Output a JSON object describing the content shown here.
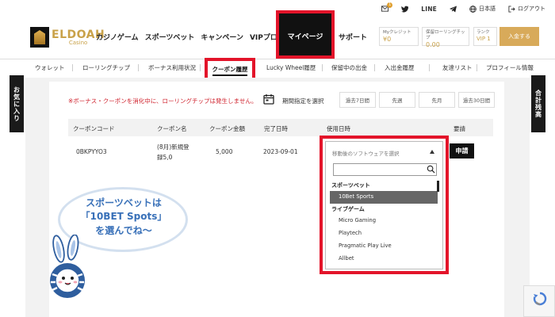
{
  "util_bar": {
    "mail_badge": "1",
    "line_label": "LINE",
    "lang_label": "日本語",
    "logout_label": "ログアウト"
  },
  "logo": {
    "main": "ELDOAH",
    "sub": "Casino"
  },
  "nav": {
    "items": [
      "カジノゲーム",
      "スポーツベット",
      "キャンペーン",
      "VIPプログラム"
    ],
    "mypage": "マイページ",
    "support": "サポート"
  },
  "account": {
    "credit_label": "Myクレジット",
    "credit_value": "¥0",
    "rolling_label": "保留ローリングチップ",
    "rolling_value": "0.00",
    "rank_label": "ランク",
    "rank_value": "VIP 1",
    "deposit_label": "入金する"
  },
  "subnav": {
    "tabs": [
      "ウォレット",
      "ローリングチップ",
      "ボーナス利用状況",
      "クーポン履歴",
      "Lucky Wheel履歴",
      "保留中の出金",
      "入出金履歴",
      "友達リスト",
      "プロフィール情報"
    ]
  },
  "side": {
    "left": "お気に入り",
    "right": "合計残高"
  },
  "notice": "※ボーナス・クーポンを消化中に、ローリングチップは発生しません。",
  "period": {
    "label": "期間指定を選択",
    "options": [
      "過去7日間",
      "先週",
      "先月",
      "過去30日間"
    ]
  },
  "table": {
    "headers": [
      "クーポンコード",
      "クーポン名",
      "クーポン金額",
      "完了日時",
      "使用日時",
      "要請"
    ],
    "row": {
      "code": "0BKPYYO3",
      "name_line1": "(8月)新規登",
      "name_line2": "録5,0",
      "amount": "5,000",
      "completed": "2023-09-01",
      "apply_label": "申請"
    }
  },
  "dropdown": {
    "placeholder": "移動後のソフトウェアを選択",
    "groups": [
      {
        "label": "スポーツベット",
        "options": [
          "10Bet Sports"
        ]
      },
      {
        "label": "ライブゲーム",
        "options": [
          "Micro Gaming",
          "Playtech",
          "Pragmatic Play Live",
          "Allbet"
        ]
      }
    ],
    "selected": "10Bet Sports"
  },
  "bubble": {
    "line1": "スポーツベットは",
    "line2": "「10BET Spots」",
    "line3": "を選んでね〜"
  },
  "colors": {
    "accent_gold": "#c9a24a",
    "highlight_red": "#e3142a",
    "bubble_blue": "#3870b8"
  }
}
